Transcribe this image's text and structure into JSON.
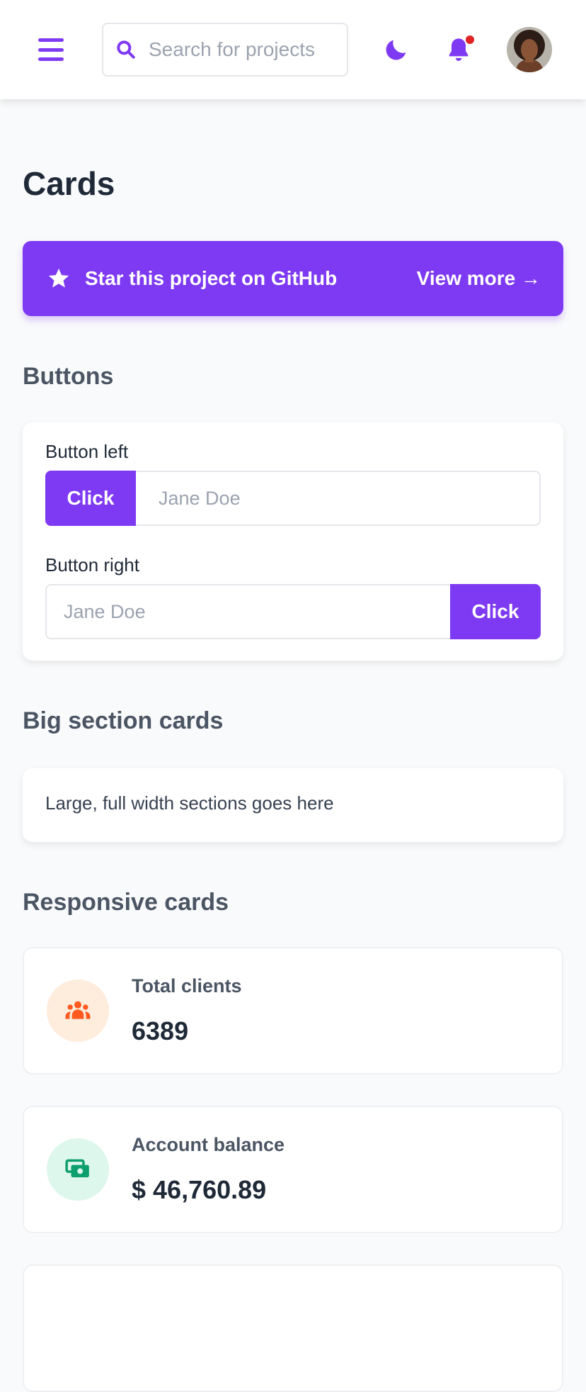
{
  "header": {
    "search_placeholder": "Search for projects",
    "accent_color": "#7e3af2",
    "notification_dot_color": "#e02424",
    "icons": [
      "menu-icon",
      "search-icon",
      "moon-icon",
      "bell-icon"
    ]
  },
  "page": {
    "title": "Cards"
  },
  "cta": {
    "label": "Star this project on GitHub",
    "action": "View more →",
    "icon": "star-icon"
  },
  "buttons_section": {
    "title": "Buttons",
    "left": {
      "label": "Button left",
      "button": "Click",
      "placeholder": "Jane Doe"
    },
    "right": {
      "label": "Button right",
      "button": "Click",
      "placeholder": "Jane Doe"
    }
  },
  "big_section": {
    "title": "Big section cards",
    "text": "Large, full width sections goes here"
  },
  "responsive_section": {
    "title": "Responsive cards",
    "cards": [
      {
        "label": "Total clients",
        "value": "6389",
        "icon": "clients-icon",
        "icon_color": "#ff5a1f",
        "icon_bg": "#feecdc"
      },
      {
        "label": "Account balance",
        "value": "$ 46,760.89",
        "icon": "money-icon",
        "icon_color": "#0e9f6e",
        "icon_bg": "#def7ec"
      }
    ]
  }
}
